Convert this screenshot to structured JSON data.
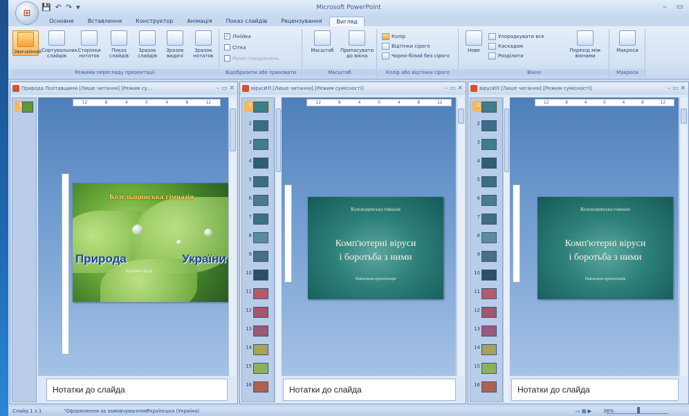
{
  "window": {
    "title": "Microsoft PowerPoint",
    "controls": [
      "–",
      "▭",
      "✕"
    ]
  },
  "qat": [
    "💾",
    "↶",
    "↷",
    "▾"
  ],
  "tabs": [
    "Основне",
    "Вставлення",
    "Конструктор",
    "Анімація",
    "Показ слайдів",
    "Рецензування",
    "Вигляд"
  ],
  "ribbon": {
    "group_views": {
      "label": "Режими перегляду презентації",
      "buttons": [
        "Звичайний",
        "Сортувальник слайдів",
        "Сторінки нотаток",
        "Показ слайдів",
        "Зразок слайдів",
        "Зразок видачі",
        "Зразок нотаток"
      ]
    },
    "group_show": {
      "label": "Відобразити або приховати",
      "checks": [
        {
          "label": "Лінійка",
          "checked": true
        },
        {
          "label": "Сітка",
          "checked": false
        },
        {
          "label": "Panel повідомлень",
          "checked": false,
          "disabled": true
        }
      ]
    },
    "group_zoom": {
      "label": "Масштаб",
      "buttons": [
        "Масштаб",
        "Припасувати до вікна"
      ]
    },
    "group_color": {
      "label": "Колір або відтінки сірого",
      "items": [
        "Колір",
        "Відтінки сірого",
        "Чорно-білий без сірого"
      ]
    },
    "group_window": {
      "label": "Вікно",
      "new_window": "Нове",
      "items": [
        "Упорядкувати все",
        "Каскадом",
        "Розділити"
      ],
      "switch": "Перехід між вікнами"
    },
    "group_macros": {
      "label": "Макроси",
      "button": "Макроси"
    }
  },
  "doc1": {
    "title": "Природа Полтавщини [Лише читання] [Режим су...",
    "thumb_nums": [
      "1"
    ],
    "slide": {
      "header": "Козельщинська гімназія",
      "title_left": "Природа",
      "title_right": "України",
      "subtitle": "Презентація"
    },
    "notes": "Нотатки до слайда"
  },
  "doc2": {
    "title": "вірусИЛ [Лише читання] [Режим сумісності]",
    "thumb_nums": [
      "1",
      "2",
      "3",
      "4",
      "5",
      "6",
      "7",
      "8",
      "9",
      "10",
      "11",
      "12",
      "13",
      "14",
      "15",
      "16"
    ],
    "slide": {
      "header": "Козельщинська гімназія",
      "line1": "Комп'ютерні віруси",
      "line2": "і боротьба з ними",
      "footer": "Навчальна презентація"
    },
    "notes": "Нотатки до слайда"
  },
  "doc3": {
    "title": "вірусИЛ [Лише читання] [Режим сумісності]",
    "thumb_nums": [
      "1",
      "2",
      "3",
      "4",
      "5",
      "6",
      "7",
      "8",
      "9",
      "10",
      "11",
      "12",
      "13",
      "14",
      "15",
      "16"
    ],
    "slide": {
      "header": "Козельщинська гімназія",
      "line1": "Комп'ютерні віруси",
      "line2": "і боротьба з ними",
      "footer": "Навчальна презентація"
    },
    "notes": "Нотатки до слайда"
  },
  "status": {
    "slide": "Слайд 1 з 1",
    "theme": "\"Оформлення за замовчуванням\"",
    "lang": "Українська (Україна)",
    "zoom": "38%"
  },
  "colors": {
    "accent_orange": "#f8b75a",
    "ribbon_blue": "#d4e2f4",
    "teal": "#2d7f7a"
  }
}
